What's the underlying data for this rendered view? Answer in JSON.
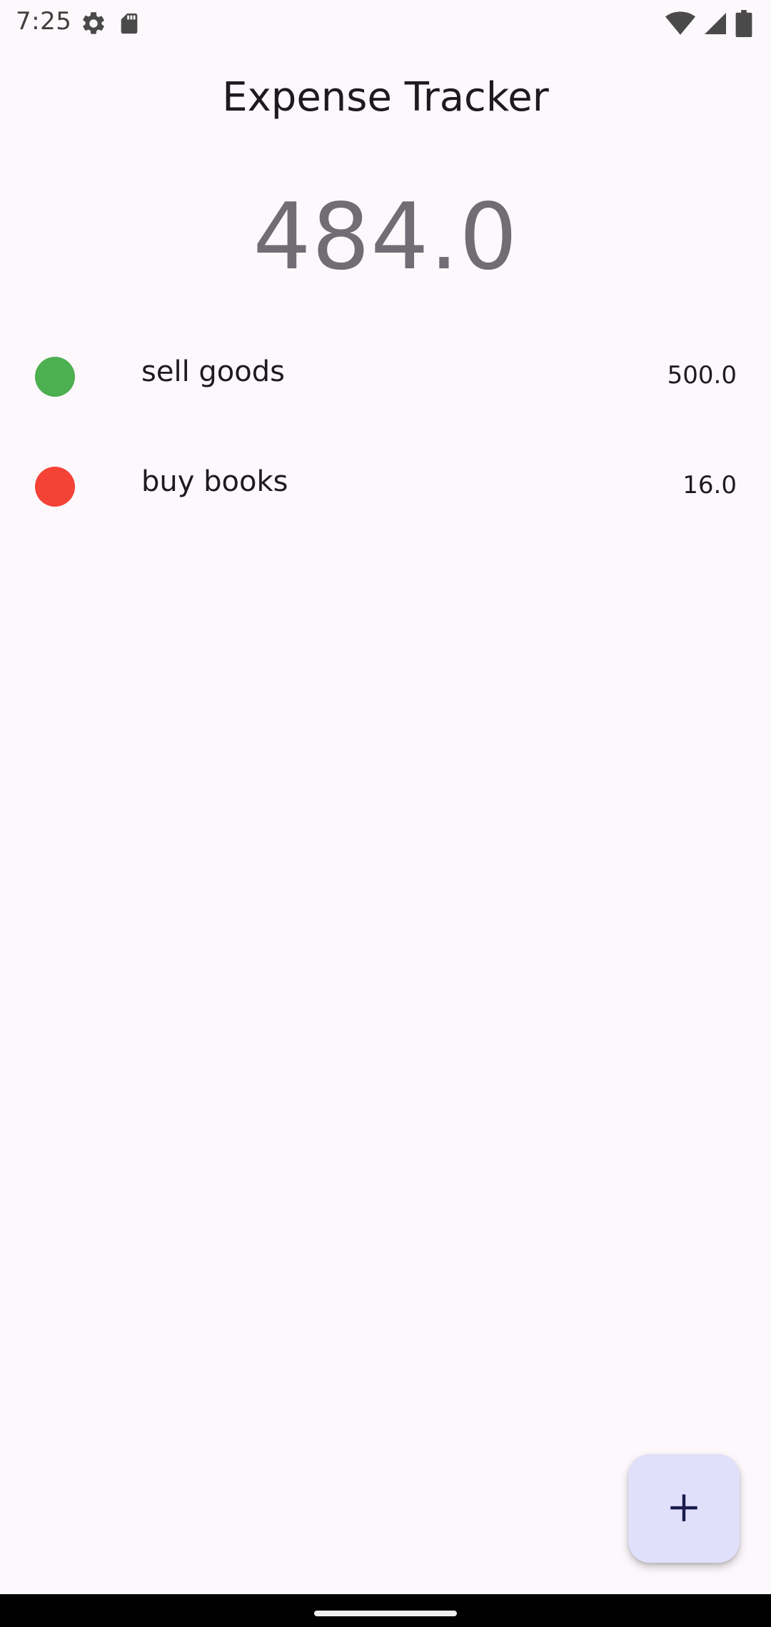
{
  "status_bar": {
    "time": "7:25",
    "icons": [
      "gear-icon",
      "sd-card-icon",
      "wifi-icon",
      "cellular-signal-icon",
      "battery-icon"
    ]
  },
  "app": {
    "title": "Expense Tracker",
    "balance": "484.0"
  },
  "transactions": [
    {
      "title": "sell goods",
      "amount": "500.0",
      "color": "#4caf50"
    },
    {
      "title": "buy books",
      "amount": "16.0",
      "color": "#f44336"
    }
  ],
  "fab": {
    "icon": "plus-icon",
    "color": "#e0e0fb"
  }
}
